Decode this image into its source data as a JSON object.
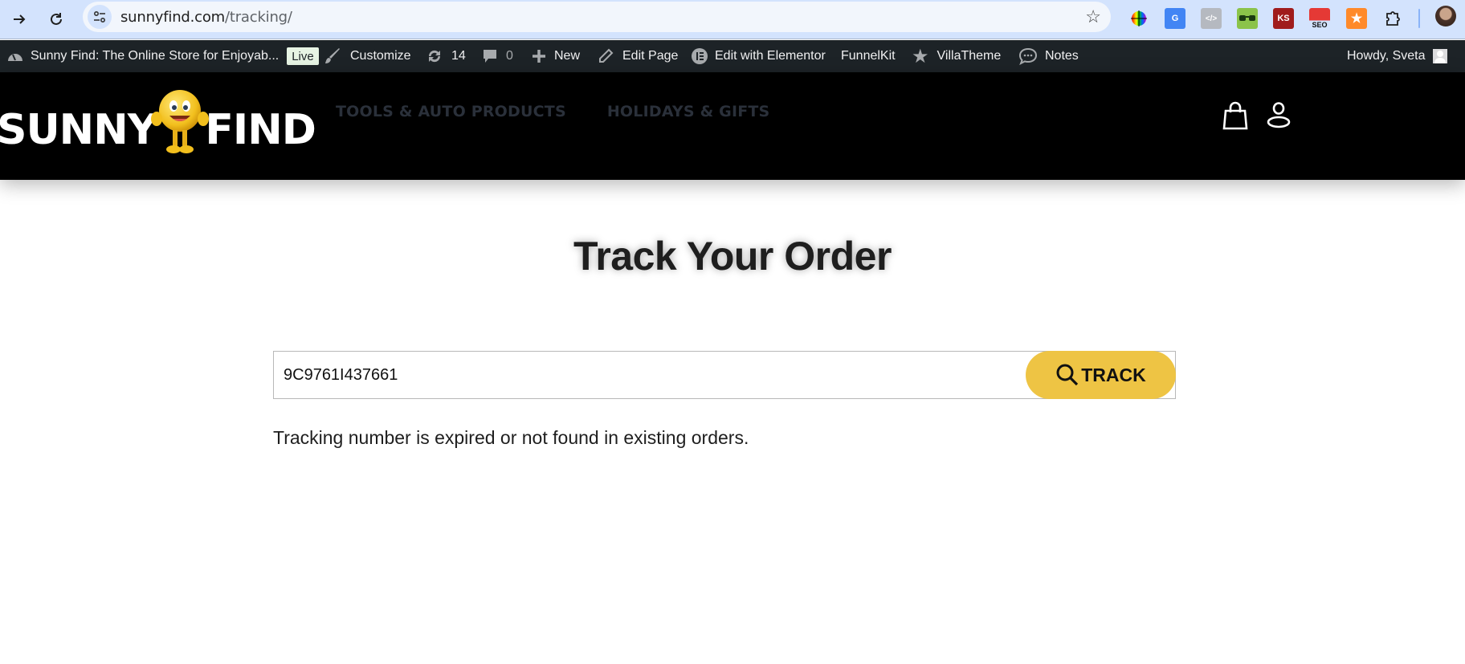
{
  "browser": {
    "url_host": "sunnyfind.com",
    "url_path": "/tracking/",
    "extensions": [
      {
        "name": "color-picker-extension-icon"
      },
      {
        "name": "google-translate-extension-icon"
      },
      {
        "name": "code-view-extension-icon"
      },
      {
        "name": "glasses-extension-icon"
      },
      {
        "name": "ks-extension-icon",
        "label": "KS"
      },
      {
        "name": "seo-extension-icon",
        "label": "SEO"
      },
      {
        "name": "star-extension-icon"
      },
      {
        "name": "extensions-puzzle-icon"
      }
    ]
  },
  "admin_bar": {
    "site_title": "Sunny Find: The Online Store for Enjoyab...",
    "live_badge": "Live",
    "customize": "Customize",
    "updates_count": "14",
    "comments_count": "0",
    "new": "New",
    "edit_page": "Edit Page",
    "edit_elementor": "Edit with Elementor",
    "funnelkit": "FunnelKit",
    "villatheme": "VillaTheme",
    "notes": "Notes",
    "howdy": "Howdy, Sveta"
  },
  "header": {
    "logo_left": "SUNNY",
    "logo_right": "FIND",
    "nav": [
      {
        "label": "TOOLS & AUTO PRODUCTS"
      },
      {
        "label": "HOLIDAYS & GIFTS"
      }
    ]
  },
  "main": {
    "title": "Track Your Order",
    "tracking_input_value": "9C9761I437661",
    "track_button": "TRACK",
    "message": "Tracking number is expired or not found in existing orders."
  },
  "colors": {
    "accent": "#eec444",
    "admin_bar": "#1d2327",
    "header_bg": "#000000",
    "nav_text": "#2a303a"
  }
}
